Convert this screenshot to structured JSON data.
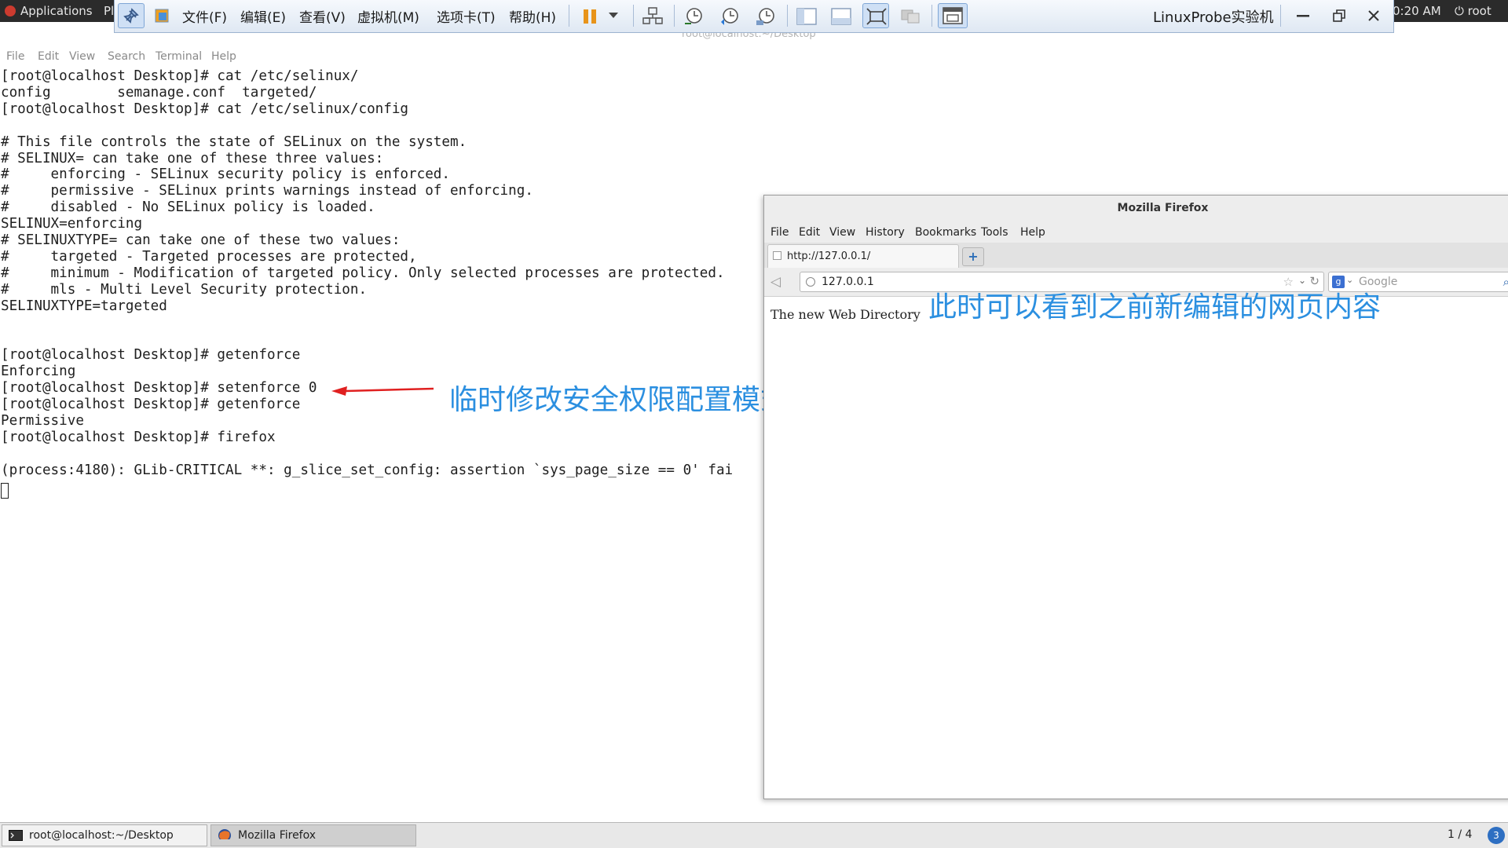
{
  "gnome": {
    "applications": "Applications",
    "places_stub": "Pl",
    "clock": "0:20 AM",
    "user": "root"
  },
  "vmware": {
    "menus": [
      "文件(F)",
      "编辑(E)",
      "查看(V)",
      "虚拟机(M)",
      "选项卡(T)",
      "帮助(H)"
    ],
    "title": "LinuxProbe实验机"
  },
  "terminal": {
    "window_title": "root@localhost:~/Desktop",
    "menus": [
      "File",
      "Edit",
      "View",
      "Search",
      "Terminal",
      "Help"
    ],
    "output": "[root@localhost Desktop]# cat /etc/selinux/\nconfig        semanage.conf  targeted/\n[root@localhost Desktop]# cat /etc/selinux/config\n\n# This file controls the state of SELinux on the system.\n# SELINUX= can take one of these three values:\n#     enforcing - SELinux security policy is enforced.\n#     permissive - SELinux prints warnings instead of enforcing.\n#     disabled - No SELinux policy is loaded.\nSELINUX=enforcing\n# SELINUXTYPE= can take one of these two values:\n#     targeted - Targeted processes are protected,\n#     minimum - Modification of targeted policy. Only selected processes are protected.\n#     mls - Multi Level Security protection.\nSELINUXTYPE=targeted\n\n\n[root@localhost Desktop]# getenforce\nEnforcing\n[root@localhost Desktop]# setenforce 0\n[root@localhost Desktop]# getenforce\nPermissive\n[root@localhost Desktop]# firefox\n\n(process:4180): GLib-CRITICAL **: g_slice_set_config: assertion `sys_page_size == 0' fai"
  },
  "annotations": {
    "setenforce_note": "临时修改安全权限配置模式",
    "firefox_note": "此时可以看到之前新编辑的网页内容"
  },
  "firefox": {
    "title": "Mozilla Firefox",
    "menus": [
      "File",
      "Edit",
      "View",
      "History",
      "Bookmarks",
      "Tools",
      "Help"
    ],
    "tab_label": "http://127.0.0.1/",
    "new_tab": "+",
    "url": "127.0.0.1",
    "search_placeholder": "Google",
    "page_text": "The new Web Directory"
  },
  "taskbar": {
    "terminal_task": "root@localhost:~/Desktop",
    "firefox_task": "Mozilla Firefox",
    "workspace": "1 / 4",
    "notifications": "3"
  },
  "colors": {
    "annotation": "#2b8fe0",
    "arrow": "#e02020"
  }
}
